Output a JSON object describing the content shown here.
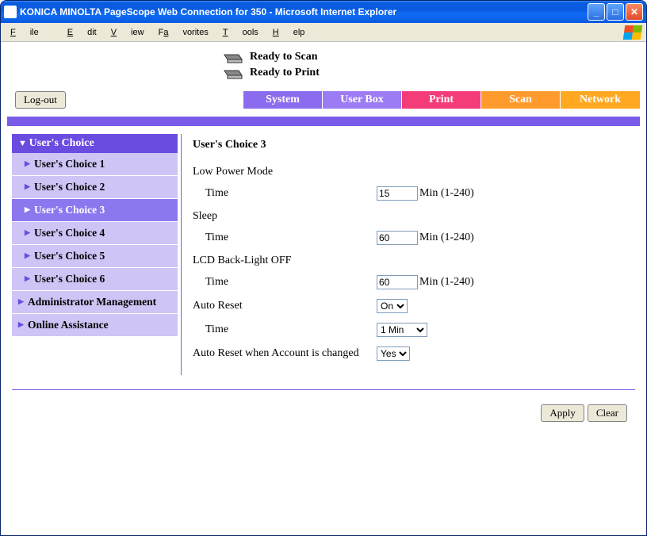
{
  "window": {
    "title": "KONICA MINOLTA PageScope Web Connection for 350 - Microsoft Internet Explorer"
  },
  "menu": {
    "file": "File",
    "edit": "Edit",
    "view": "View",
    "favorites": "Favorites",
    "tools": "Tools",
    "help": "Help"
  },
  "status": {
    "scan": "Ready to Scan",
    "print": "Ready to Print"
  },
  "logout": "Log-out",
  "tabs": {
    "system": "System",
    "userbox": "User Box",
    "print": "Print",
    "scan": "Scan",
    "network": "Network"
  },
  "sidebar": {
    "header": "User's Choice",
    "choice1": "User's Choice 1",
    "choice2": "User's Choice 2",
    "choice3": "User's Choice 3",
    "choice4": "User's Choice 4",
    "choice5": "User's Choice 5",
    "choice6": "User's Choice 6",
    "admin": "Administrator Management",
    "online": "Online Assistance"
  },
  "panel": {
    "title": "User's Choice 3",
    "low_power_label": "Low Power Mode",
    "time_label": "Time",
    "low_power_value": "15",
    "min_suffix": "Min (1-240)",
    "sleep_label": "Sleep",
    "sleep_value": "60",
    "lcd_label": "LCD Back-Light OFF",
    "lcd_value": "60",
    "auto_reset_label": "Auto Reset",
    "auto_reset_value": "On",
    "auto_reset_time_value": "1 Min",
    "acct_reset_label": "Auto Reset when Account is changed",
    "acct_reset_value": "Yes"
  },
  "buttons": {
    "apply": "Apply",
    "clear": "Clear"
  }
}
